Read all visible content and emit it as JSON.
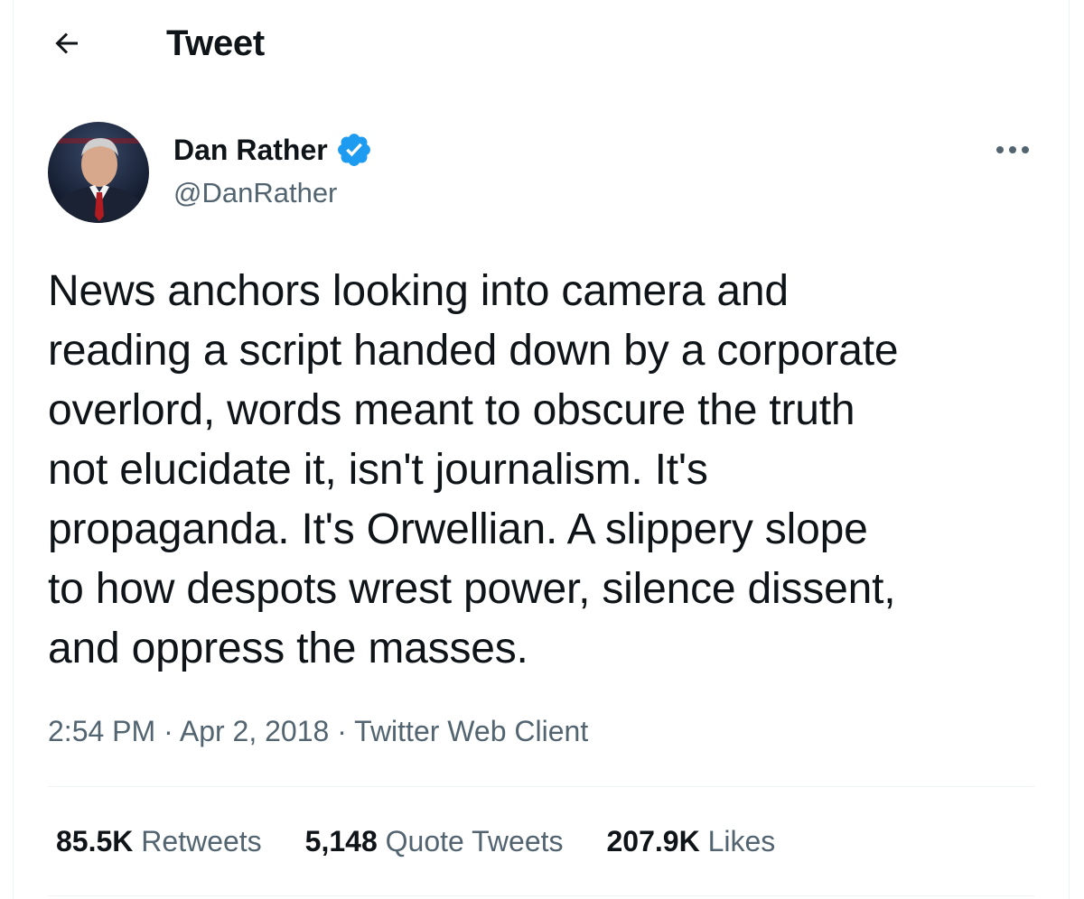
{
  "header": {
    "back_icon": "arrow-left-icon",
    "title": "Tweet"
  },
  "author": {
    "display_name": "Dan Rather",
    "handle": "@DanRather",
    "verified": true,
    "verified_icon": "verified-badge-icon",
    "verified_color": "#1d9bf0",
    "more_icon": "more-dots-icon"
  },
  "tweet": {
    "lines": [
      "News anchors looking into camera and",
      "reading a script handed down by a corporate",
      "overlord, words meant to obscure the truth",
      "not elucidate it, isn't journalism. It's",
      "propaganda. It's Orwellian. A slippery slope",
      "to how despots wrest power, silence dissent,",
      "and oppress the masses."
    ]
  },
  "meta": {
    "time": "2:54 PM",
    "separator": " · ",
    "date": "Apr 2, 2018",
    "client": "Twitter Web Client"
  },
  "stats": {
    "retweets_count": "85.5K",
    "retweets_label": "Retweets",
    "quotes_count": "5,148",
    "quotes_label": "Quote Tweets",
    "likes_count": "207.9K",
    "likes_label": "Likes"
  },
  "colors": {
    "text_primary": "#0f1419",
    "text_secondary": "#536471",
    "divider": "#eff3f4",
    "accent": "#1d9bf0"
  }
}
